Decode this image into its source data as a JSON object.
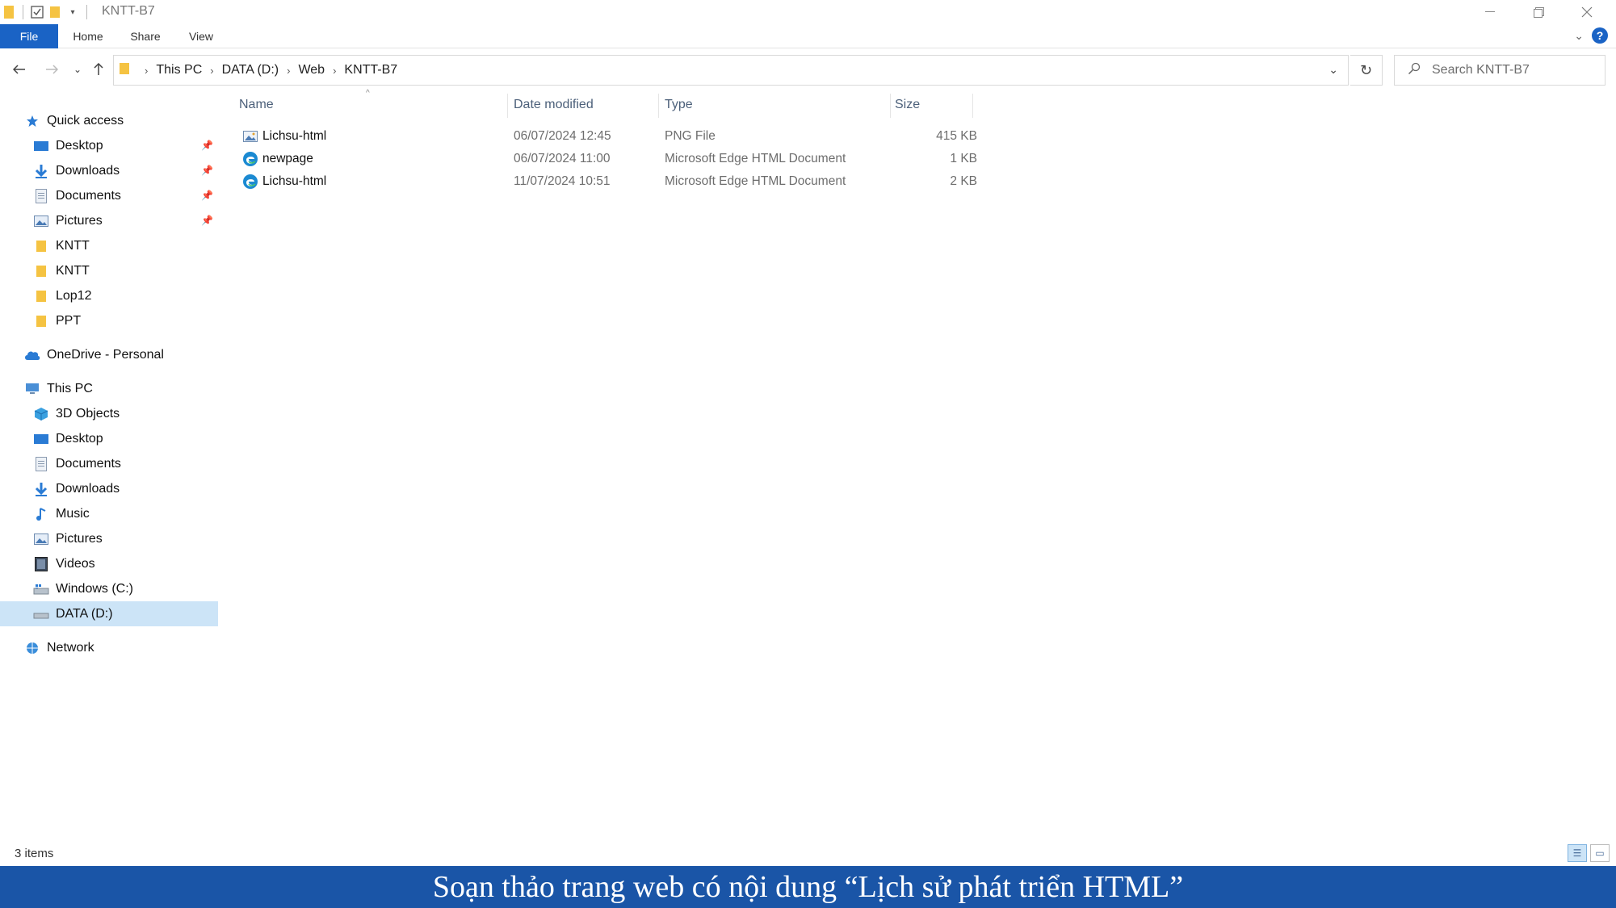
{
  "window": {
    "title": "KNTT-B7"
  },
  "ribbon": {
    "tabs": [
      "File",
      "Home",
      "Share",
      "View"
    ]
  },
  "address": {
    "crumbs": [
      "This PC",
      "DATA (D:)",
      "Web",
      "KNTT-B7"
    ],
    "search_placeholder": "Search KNTT-B7"
  },
  "nav": {
    "quick_access": "Quick access",
    "quick_items": [
      {
        "label": "Desktop",
        "icon": "desktop-icon"
      },
      {
        "label": "Downloads",
        "icon": "downloads-icon"
      },
      {
        "label": "Documents",
        "icon": "documents-icon"
      },
      {
        "label": "Pictures",
        "icon": "pictures-icon"
      },
      {
        "label": "KNTT",
        "icon": "folder-icon"
      },
      {
        "label": "KNTT",
        "icon": "folder-icon"
      },
      {
        "label": "Lop12",
        "icon": "folder-icon"
      },
      {
        "label": "PPT",
        "icon": "folder-icon"
      }
    ],
    "onedrive": "OneDrive - Personal",
    "this_pc": "This PC",
    "pc_items": [
      {
        "label": "3D Objects",
        "icon": "3d-objects-icon"
      },
      {
        "label": "Desktop",
        "icon": "desktop-icon"
      },
      {
        "label": "Documents",
        "icon": "documents-icon"
      },
      {
        "label": "Downloads",
        "icon": "downloads-icon"
      },
      {
        "label": "Music",
        "icon": "music-icon"
      },
      {
        "label": "Pictures",
        "icon": "pictures-icon"
      },
      {
        "label": "Videos",
        "icon": "videos-icon"
      },
      {
        "label": "Windows (C:)",
        "icon": "drive-c-icon"
      },
      {
        "label": "DATA (D:)",
        "icon": "drive-d-icon"
      }
    ],
    "network": "Network"
  },
  "columns": {
    "name": "Name",
    "date": "Date modified",
    "type": "Type",
    "size": "Size"
  },
  "files": [
    {
      "name": "Lichsu-html",
      "date": "06/07/2024 12:45",
      "type": "PNG File",
      "size": "415 KB",
      "icon": "png-file-icon"
    },
    {
      "name": "newpage",
      "date": "06/07/2024 11:00",
      "type": "Microsoft Edge HTML Document",
      "size": "1 KB",
      "icon": "edge-icon"
    },
    {
      "name": "Lichsu-html",
      "date": "11/07/2024 10:51",
      "type": "Microsoft Edge HTML Document",
      "size": "2 KB",
      "icon": "edge-icon"
    }
  ],
  "status": {
    "item_count": "3 items"
  },
  "caption": "Soạn thảo trang web có nội dung “Lịch sử phát triển HTML”",
  "colors": {
    "accent": "#1a63c5",
    "selection": "#cce4f7",
    "caption_bg": "#1a55a7"
  }
}
